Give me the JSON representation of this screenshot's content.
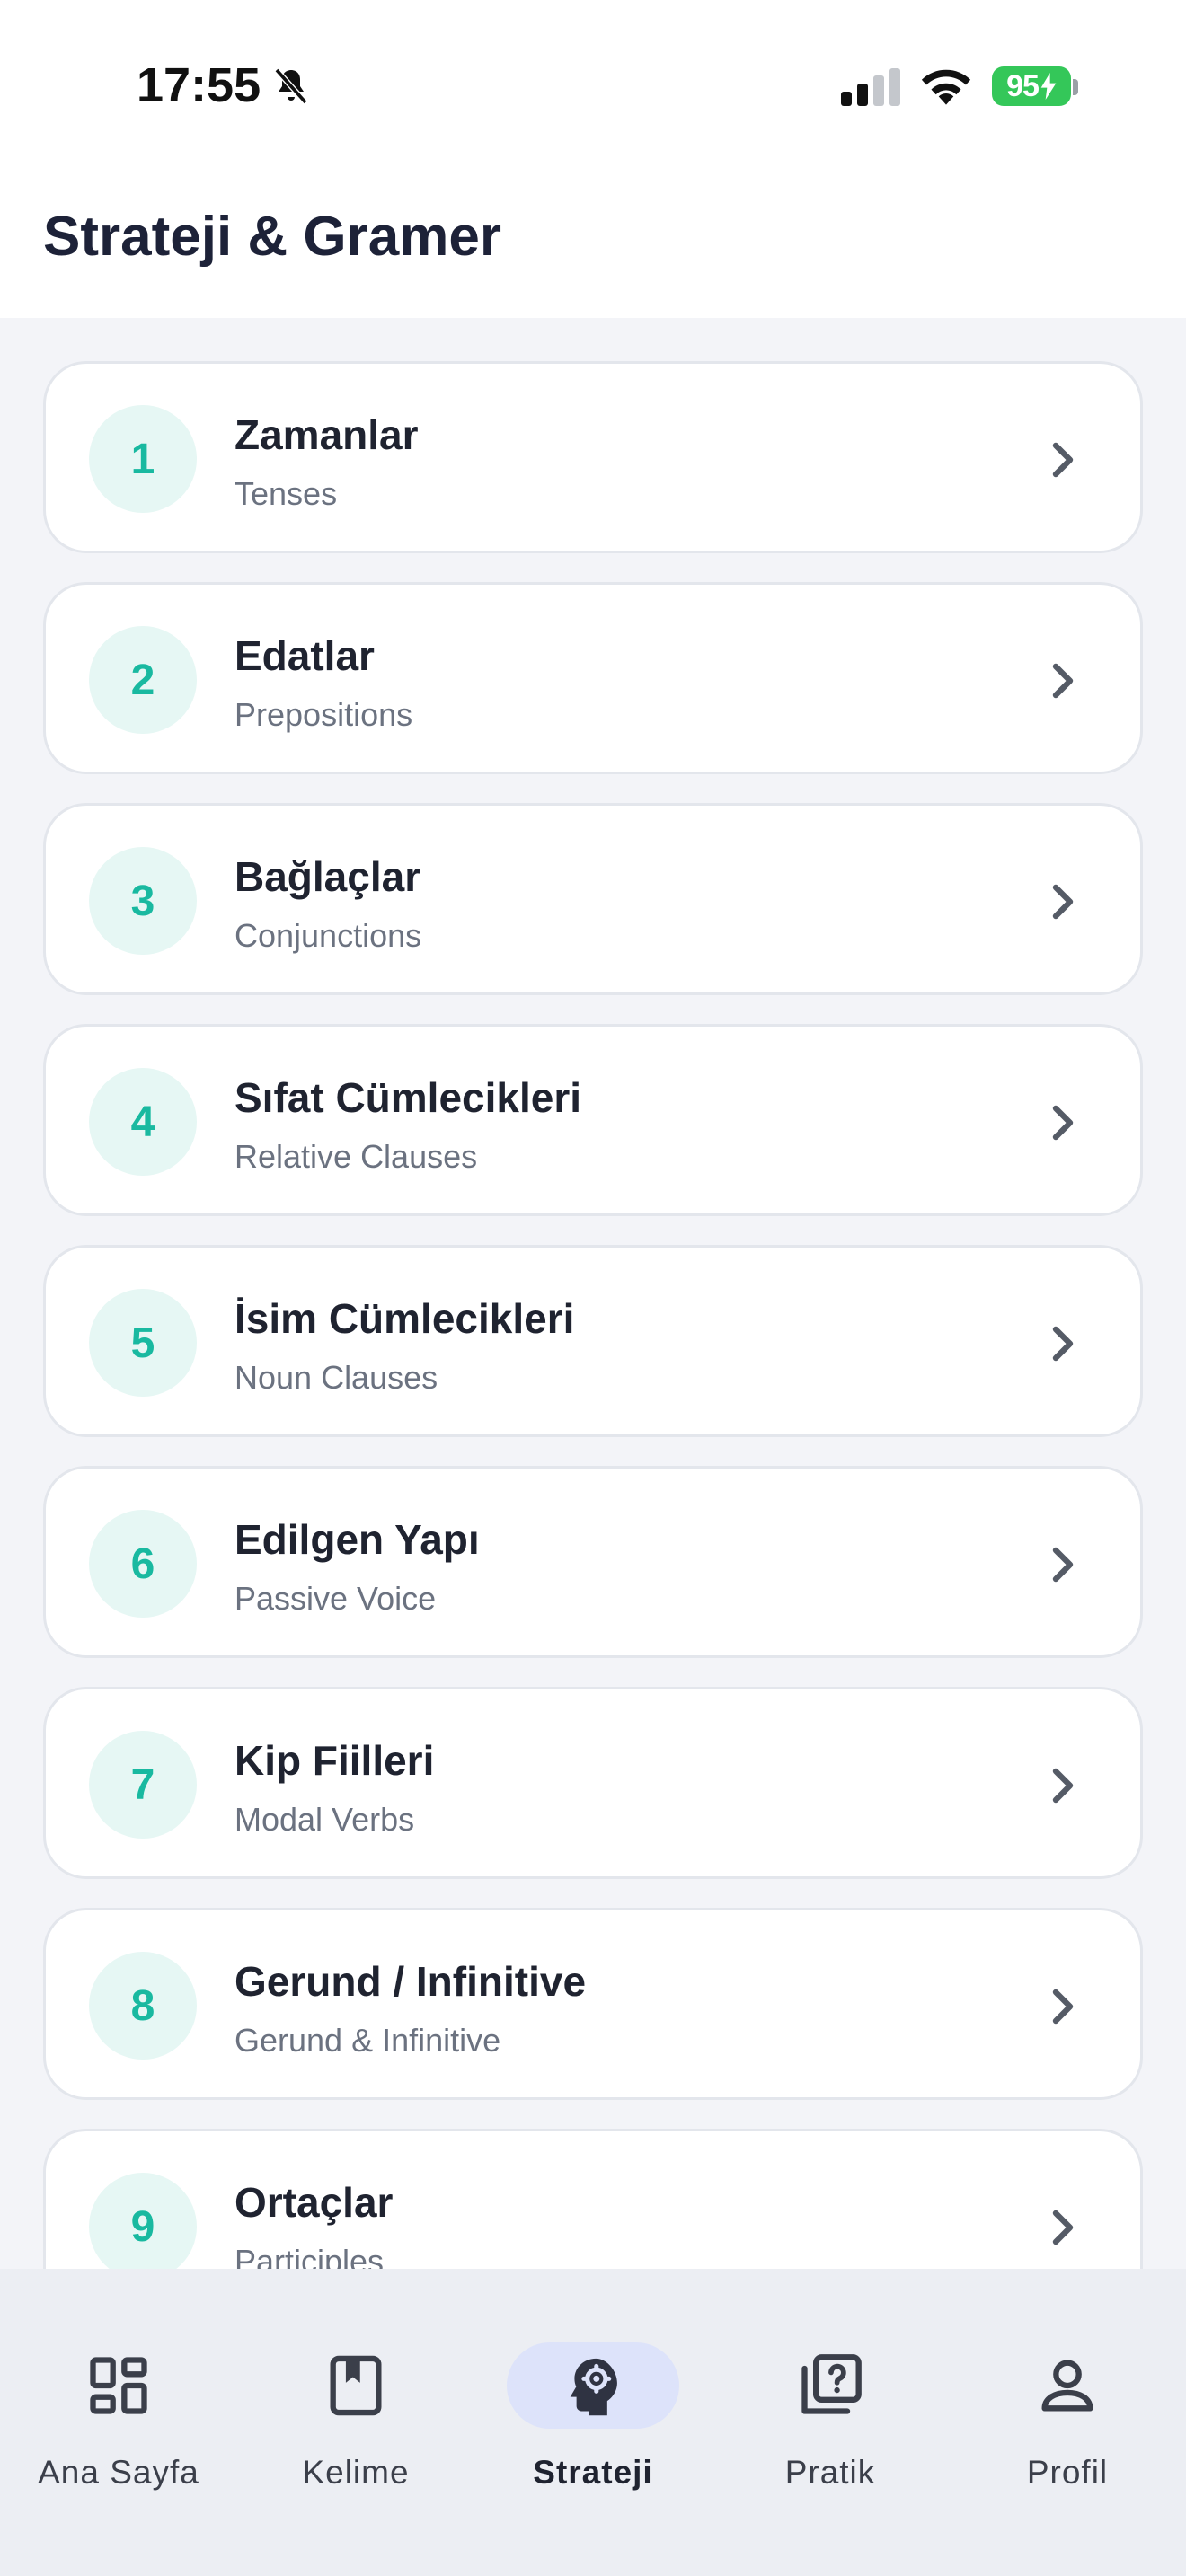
{
  "status_bar": {
    "time": "17:55",
    "battery": "95"
  },
  "header": {
    "title": "Strateji & Gramer"
  },
  "topics": [
    {
      "number": "1",
      "title": "Zamanlar",
      "subtitle": "Tenses"
    },
    {
      "number": "2",
      "title": "Edatlar",
      "subtitle": "Prepositions"
    },
    {
      "number": "3",
      "title": "Bağlaçlar",
      "subtitle": "Conjunctions"
    },
    {
      "number": "4",
      "title": "Sıfat Cümlecikleri",
      "subtitle": "Relative Clauses"
    },
    {
      "number": "5",
      "title": "İsim Cümlecikleri",
      "subtitle": "Noun Clauses"
    },
    {
      "number": "6",
      "title": "Edilgen Yapı",
      "subtitle": "Passive Voice"
    },
    {
      "number": "7",
      "title": "Kip Fiilleri",
      "subtitle": "Modal Verbs"
    },
    {
      "number": "8",
      "title": "Gerund / Infinitive",
      "subtitle": "Gerund & Infinitive"
    },
    {
      "number": "9",
      "title": "Ortaçlar",
      "subtitle": "Participles"
    }
  ],
  "bottom_nav": {
    "items": [
      {
        "label": "Ana Sayfa",
        "icon": "dashboard-icon",
        "active": false
      },
      {
        "label": "Kelime",
        "icon": "bookmark-book-icon",
        "active": false
      },
      {
        "label": "Strateji",
        "icon": "head-gear-icon",
        "active": true
      },
      {
        "label": "Pratik",
        "icon": "quiz-icon",
        "active": false
      },
      {
        "label": "Profil",
        "icon": "person-icon",
        "active": false
      }
    ]
  },
  "colors": {
    "accent": "#19b9a0",
    "accent_bg": "#e6f7f4",
    "nav_active_bg": "#dde3fa",
    "battery": "#34c759"
  }
}
